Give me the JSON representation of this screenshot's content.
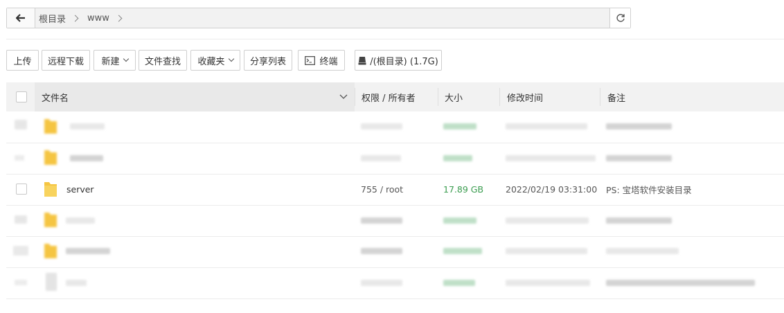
{
  "pathbar": {
    "back_icon": "arrow-left-icon",
    "crumbs": [
      "根目录",
      "www"
    ],
    "refresh_icon": "refresh-icon"
  },
  "toolbar": {
    "upload": "上传",
    "remote_download": "远程下载",
    "new": "新建",
    "file_search": "文件查找",
    "favorites": "收藏夹",
    "share_list": "分享列表",
    "terminal": "终端",
    "disk": "/(根目录) (1.7G)"
  },
  "table": {
    "headers": {
      "name": "文件名",
      "perm": "权限 / 所有者",
      "size": "大小",
      "mtime": "修改时间",
      "note": "备注"
    },
    "rows": [
      {
        "name": "",
        "perm": "",
        "size": "",
        "mtime": "",
        "note": "",
        "blurred": true
      },
      {
        "name": "",
        "perm": "",
        "size": "",
        "mtime": "",
        "note": "",
        "blurred": true
      },
      {
        "name": "server",
        "perm": "755 / root",
        "size": "17.89 GB",
        "mtime": "2022/02/19 03:31:00",
        "note": "PS: 宝塔软件安装目录",
        "blurred": false
      },
      {
        "name": "",
        "perm": "",
        "size": "",
        "mtime": "",
        "note": "",
        "blurred": true
      },
      {
        "name": "",
        "perm": "",
        "size": "",
        "mtime": "",
        "note": "",
        "blurred": true
      },
      {
        "name": "",
        "perm": "",
        "size": "",
        "mtime": "",
        "note": "",
        "blurred": true
      }
    ]
  },
  "colors": {
    "size_green": "#3a9c4f",
    "folder_yellow": "#f5c542",
    "header_bg": "#f2f2f2"
  }
}
